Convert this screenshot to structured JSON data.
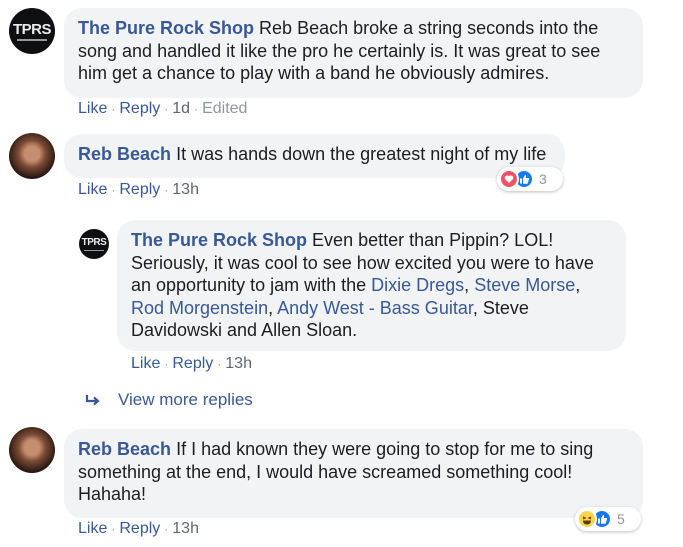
{
  "comments": [
    {
      "author": "The Pure Rock Shop",
      "avatar_text": "TPRS",
      "text": "Reb Beach broke a string seconds into the song and handled it like the pro he certainly is. It was great to see him get a chance to play with a band he obviously admires.",
      "like": "Like",
      "reply": "Reply",
      "time": "1d",
      "edited": "Edited"
    },
    {
      "author": "Reb Beach",
      "text": "It was hands down the greatest night of my life",
      "like": "Like",
      "reply": "Reply",
      "time": "13h",
      "reaction_count": "3",
      "reaction_icons": [
        "love-icon",
        "like-icon"
      ]
    },
    {
      "author": "The Pure Rock Shop",
      "avatar_text": "TPRS",
      "text_before": "Even better than Pippin? LOL! Seriously, it was cool to see how excited you were to have an opportunity to jam with the ",
      "tag1": "Dixie Dregs",
      "sep1": ", ",
      "tag2": "Steve Morse",
      "sep2": ", ",
      "tag3": "Rod Morgenstein",
      "sep3": ", ",
      "tag4": "Andy West - Bass Guitar",
      "text_after": ", Steve Davidowski and Allen Sloan.",
      "like": "Like",
      "reply": "Reply",
      "time": "13h"
    },
    {
      "author": "Reb Beach",
      "text": "If I had known they were going to stop for me to sing something at the end, I would have screamed something cool! Hahaha!",
      "like": "Like",
      "reply": "Reply",
      "time": "13h",
      "reaction_count": "5",
      "reaction_icons": [
        "haha-icon",
        "like-icon"
      ]
    }
  ],
  "view_more_replies": "View more replies",
  "separator": "·",
  "colors": {
    "link": "#385898",
    "bubble": "#f2f3f5",
    "meta": "#616770",
    "love": "#f25268",
    "like": "#1877f2",
    "haha": "#fcd34d"
  }
}
